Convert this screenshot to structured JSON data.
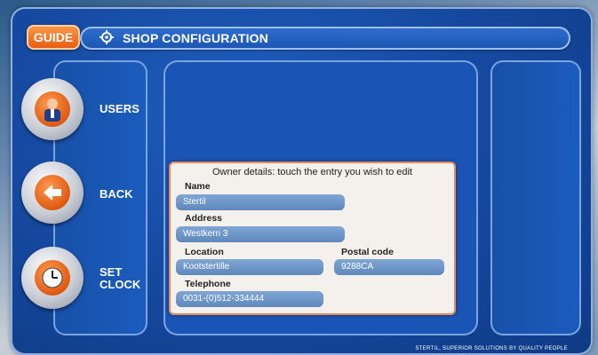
{
  "header": {
    "guide_label": "GUIDE",
    "title": "SHOP CONFIGURATION",
    "title_icon": "gear-settings-icon"
  },
  "sidebar": {
    "items": [
      {
        "label": "USERS",
        "icon": "user-icon"
      },
      {
        "label": "BACK",
        "icon": "back-arrow-icon"
      },
      {
        "label": "SET CLOCK",
        "icon": "clock-icon"
      }
    ]
  },
  "dialog": {
    "title": "Owner details: touch the entry you wish to edit",
    "fields": {
      "name": {
        "label": "Name",
        "value": "Stertil"
      },
      "address": {
        "label": "Address",
        "value": "Westkern 3"
      },
      "location": {
        "label": "Location",
        "value": "Kootstertille"
      },
      "postal_code": {
        "label": "Postal code",
        "value": "9288CA"
      },
      "telephone": {
        "label": "Telephone",
        "value": "0031-(0)512-334444"
      }
    }
  },
  "footer": {
    "text": "STERTIL, SUPERIOR SOLUTIONS BY QUALITY PEOPLE"
  },
  "colors": {
    "accent": "#e25a10",
    "panel_blue": "#1a54b4",
    "field_blue": "#6f97c8"
  }
}
